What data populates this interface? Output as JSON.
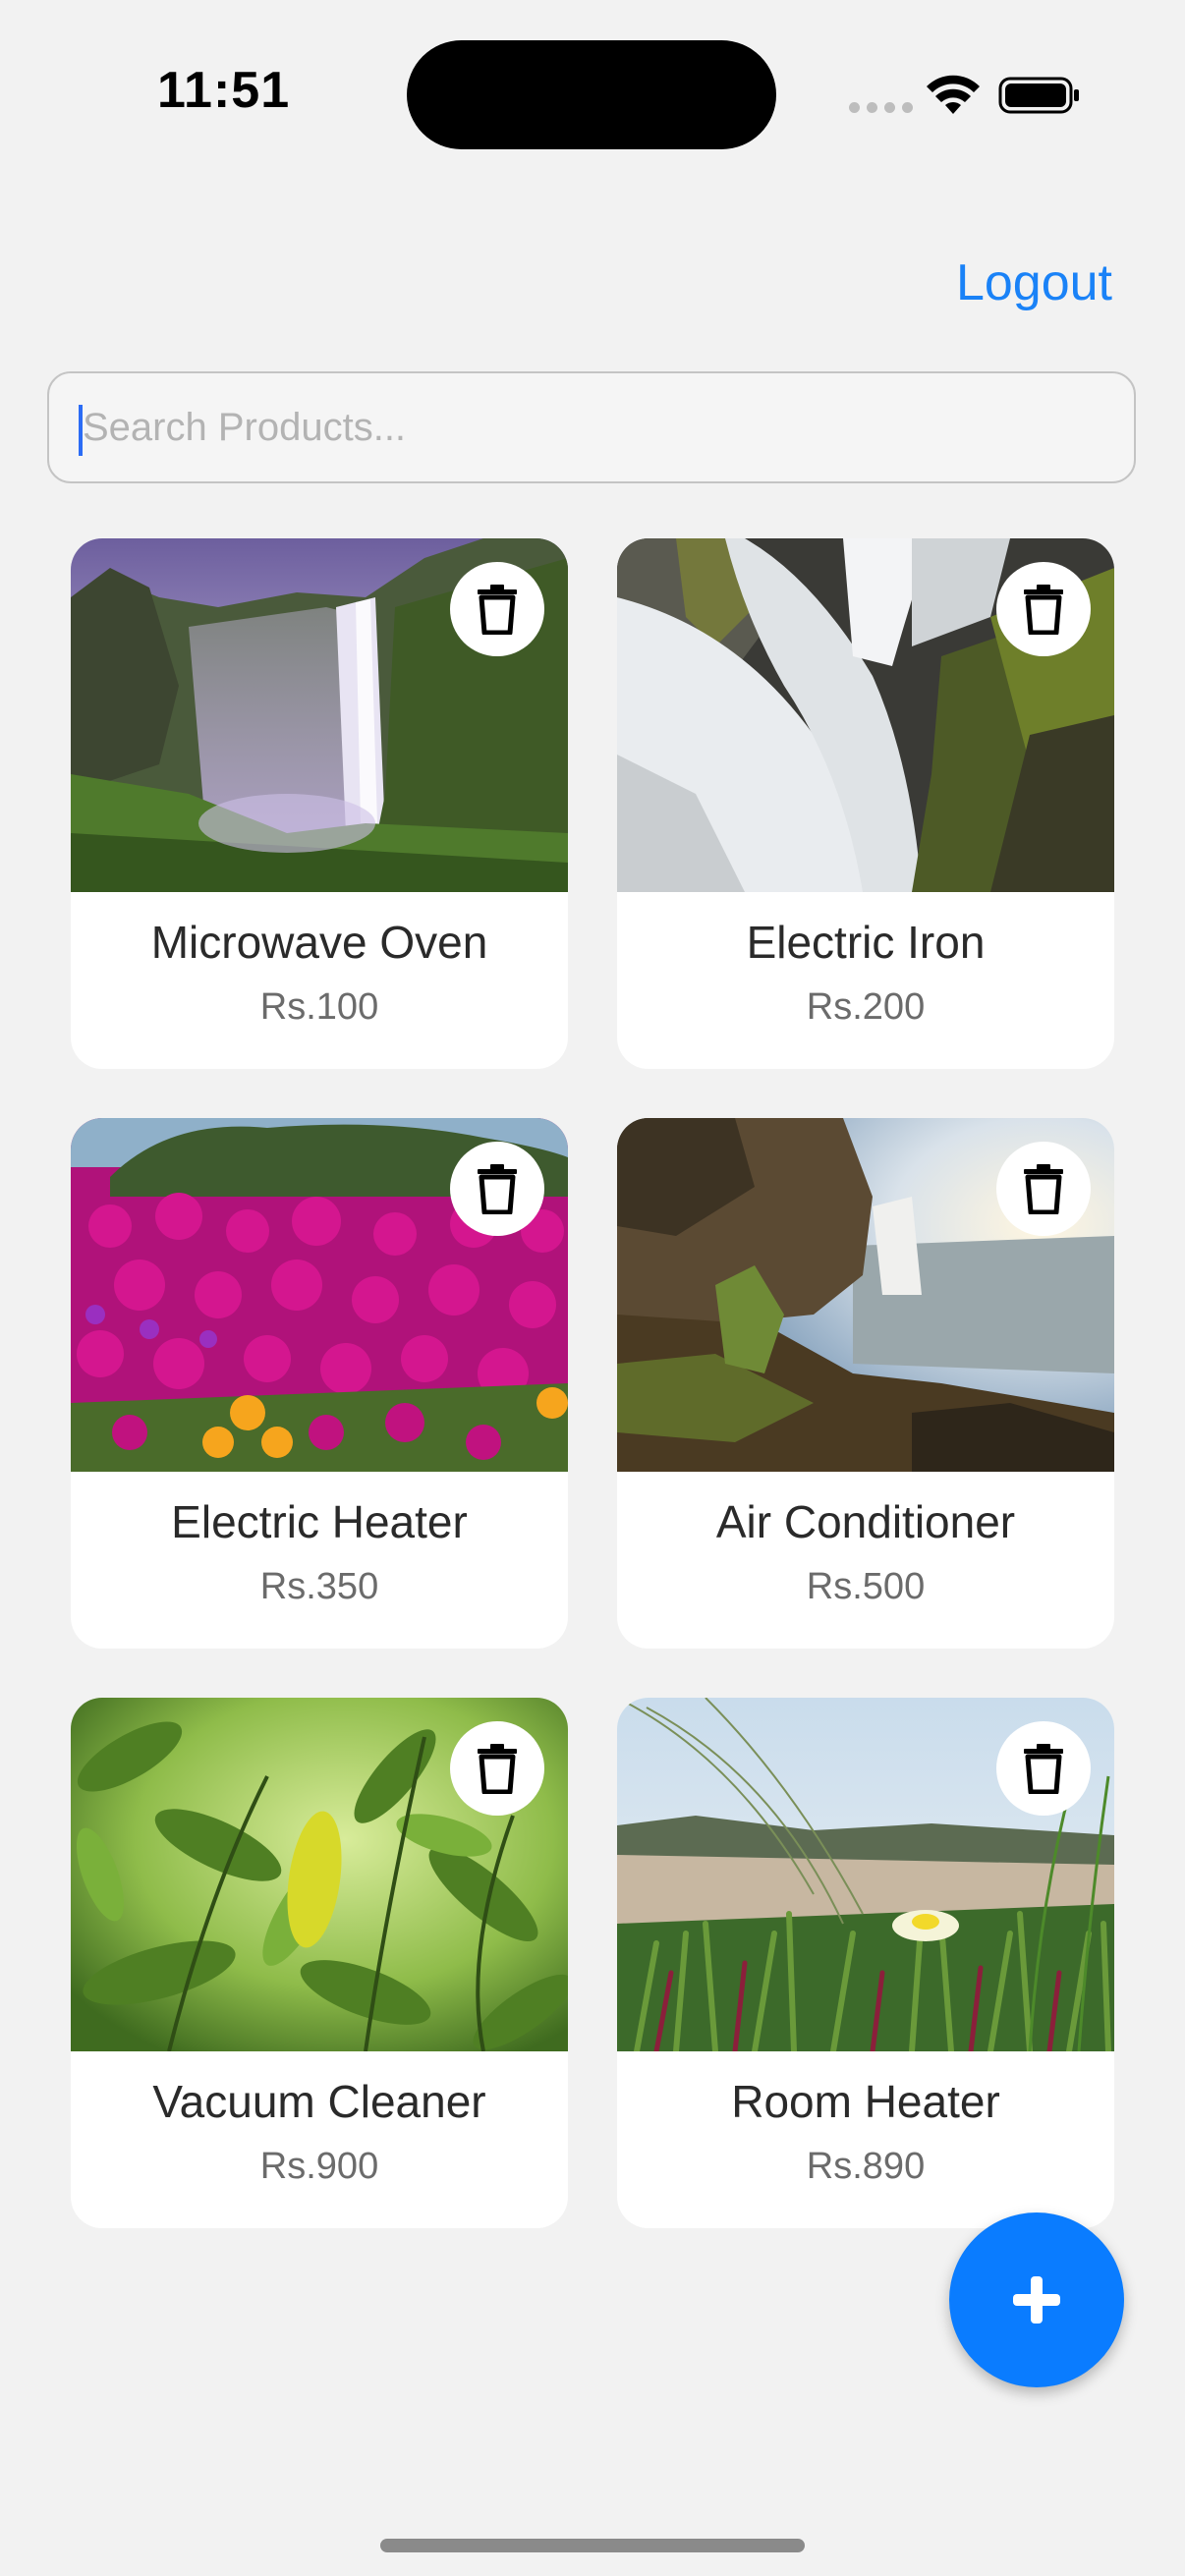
{
  "status_bar": {
    "time": "11:51"
  },
  "header": {
    "logout_label": "Logout",
    "accent_color": "#1a82f7"
  },
  "search": {
    "placeholder": "Search Products...",
    "value": ""
  },
  "products": [
    {
      "name": "Microwave Oven",
      "price": "Rs.100",
      "image": "waterfall-purple-sky-photo"
    },
    {
      "name": "Electric Iron",
      "price": "Rs.200",
      "image": "waterfall-mossy-rocks-photo"
    },
    {
      "name": "Electric Heater",
      "price": "Rs.350",
      "image": "magenta-flowers-photo"
    },
    {
      "name": "Air Conditioner",
      "price": "Rs.500",
      "image": "waterfall-cliff-sunlight-photo"
    },
    {
      "name": "Vacuum Cleaner",
      "price": "Rs.900",
      "image": "green-leaves-photo"
    },
    {
      "name": "Room Heater",
      "price": "Rs.890",
      "image": "grass-yellow-flower-photo"
    }
  ],
  "icons": {
    "delete": "trash-icon",
    "add": "plus-icon"
  },
  "colors": {
    "fab": "#0a7cff",
    "background": "#f2f2f2"
  }
}
